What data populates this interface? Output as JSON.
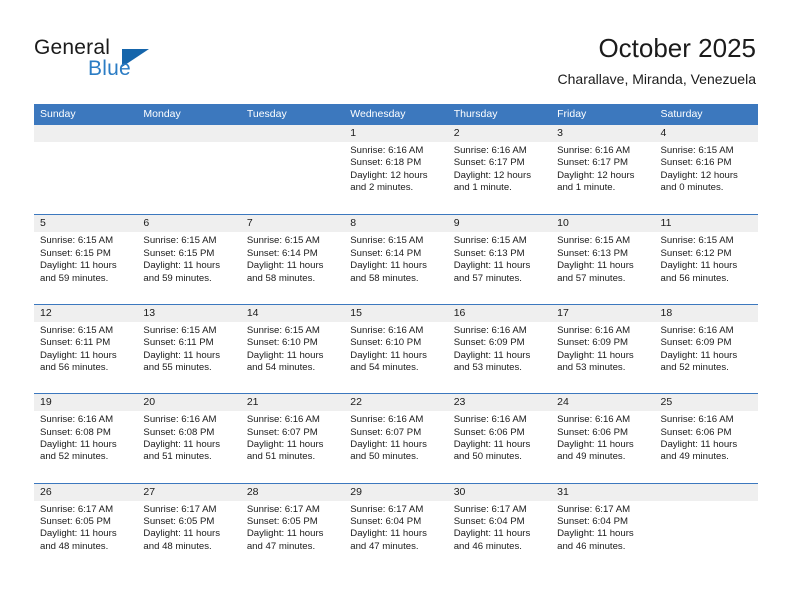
{
  "logo": {
    "top_text": "General",
    "bottom_text": "Blue",
    "triangle_icon": "triangle-icon",
    "brand_blue": "#2b7cc4",
    "triangle_color": "#1565ab"
  },
  "header": {
    "title": "October 2025",
    "subtitle": "Charallave, Miranda, Venezuela"
  },
  "colors": {
    "header_band": "#3c78be",
    "day_strip": "#efefef",
    "text": "#1b1b1b"
  },
  "weekdays": [
    "Sunday",
    "Monday",
    "Tuesday",
    "Wednesday",
    "Thursday",
    "Friday",
    "Saturday"
  ],
  "weeks": [
    [
      {
        "empty": true,
        "day": "",
        "sunrise": "",
        "sunset": "",
        "daylight": ""
      },
      {
        "empty": true,
        "day": "",
        "sunrise": "",
        "sunset": "",
        "daylight": ""
      },
      {
        "empty": true,
        "day": "",
        "sunrise": "",
        "sunset": "",
        "daylight": ""
      },
      {
        "empty": false,
        "day": "1",
        "sunrise": "Sunrise: 6:16 AM",
        "sunset": "Sunset: 6:18 PM",
        "daylight": "Daylight: 12 hours and 2 minutes."
      },
      {
        "empty": false,
        "day": "2",
        "sunrise": "Sunrise: 6:16 AM",
        "sunset": "Sunset: 6:17 PM",
        "daylight": "Daylight: 12 hours and 1 minute."
      },
      {
        "empty": false,
        "day": "3",
        "sunrise": "Sunrise: 6:16 AM",
        "sunset": "Sunset: 6:17 PM",
        "daylight": "Daylight: 12 hours and 1 minute."
      },
      {
        "empty": false,
        "day": "4",
        "sunrise": "Sunrise: 6:15 AM",
        "sunset": "Sunset: 6:16 PM",
        "daylight": "Daylight: 12 hours and 0 minutes."
      }
    ],
    [
      {
        "empty": false,
        "day": "5",
        "sunrise": "Sunrise: 6:15 AM",
        "sunset": "Sunset: 6:15 PM",
        "daylight": "Daylight: 11 hours and 59 minutes."
      },
      {
        "empty": false,
        "day": "6",
        "sunrise": "Sunrise: 6:15 AM",
        "sunset": "Sunset: 6:15 PM",
        "daylight": "Daylight: 11 hours and 59 minutes."
      },
      {
        "empty": false,
        "day": "7",
        "sunrise": "Sunrise: 6:15 AM",
        "sunset": "Sunset: 6:14 PM",
        "daylight": "Daylight: 11 hours and 58 minutes."
      },
      {
        "empty": false,
        "day": "8",
        "sunrise": "Sunrise: 6:15 AM",
        "sunset": "Sunset: 6:14 PM",
        "daylight": "Daylight: 11 hours and 58 minutes."
      },
      {
        "empty": false,
        "day": "9",
        "sunrise": "Sunrise: 6:15 AM",
        "sunset": "Sunset: 6:13 PM",
        "daylight": "Daylight: 11 hours and 57 minutes."
      },
      {
        "empty": false,
        "day": "10",
        "sunrise": "Sunrise: 6:15 AM",
        "sunset": "Sunset: 6:13 PM",
        "daylight": "Daylight: 11 hours and 57 minutes."
      },
      {
        "empty": false,
        "day": "11",
        "sunrise": "Sunrise: 6:15 AM",
        "sunset": "Sunset: 6:12 PM",
        "daylight": "Daylight: 11 hours and 56 minutes."
      }
    ],
    [
      {
        "empty": false,
        "day": "12",
        "sunrise": "Sunrise: 6:15 AM",
        "sunset": "Sunset: 6:11 PM",
        "daylight": "Daylight: 11 hours and 56 minutes."
      },
      {
        "empty": false,
        "day": "13",
        "sunrise": "Sunrise: 6:15 AM",
        "sunset": "Sunset: 6:11 PM",
        "daylight": "Daylight: 11 hours and 55 minutes."
      },
      {
        "empty": false,
        "day": "14",
        "sunrise": "Sunrise: 6:15 AM",
        "sunset": "Sunset: 6:10 PM",
        "daylight": "Daylight: 11 hours and 54 minutes."
      },
      {
        "empty": false,
        "day": "15",
        "sunrise": "Sunrise: 6:16 AM",
        "sunset": "Sunset: 6:10 PM",
        "daylight": "Daylight: 11 hours and 54 minutes."
      },
      {
        "empty": false,
        "day": "16",
        "sunrise": "Sunrise: 6:16 AM",
        "sunset": "Sunset: 6:09 PM",
        "daylight": "Daylight: 11 hours and 53 minutes."
      },
      {
        "empty": false,
        "day": "17",
        "sunrise": "Sunrise: 6:16 AM",
        "sunset": "Sunset: 6:09 PM",
        "daylight": "Daylight: 11 hours and 53 minutes."
      },
      {
        "empty": false,
        "day": "18",
        "sunrise": "Sunrise: 6:16 AM",
        "sunset": "Sunset: 6:09 PM",
        "daylight": "Daylight: 11 hours and 52 minutes."
      }
    ],
    [
      {
        "empty": false,
        "day": "19",
        "sunrise": "Sunrise: 6:16 AM",
        "sunset": "Sunset: 6:08 PM",
        "daylight": "Daylight: 11 hours and 52 minutes."
      },
      {
        "empty": false,
        "day": "20",
        "sunrise": "Sunrise: 6:16 AM",
        "sunset": "Sunset: 6:08 PM",
        "daylight": "Daylight: 11 hours and 51 minutes."
      },
      {
        "empty": false,
        "day": "21",
        "sunrise": "Sunrise: 6:16 AM",
        "sunset": "Sunset: 6:07 PM",
        "daylight": "Daylight: 11 hours and 51 minutes."
      },
      {
        "empty": false,
        "day": "22",
        "sunrise": "Sunrise: 6:16 AM",
        "sunset": "Sunset: 6:07 PM",
        "daylight": "Daylight: 11 hours and 50 minutes."
      },
      {
        "empty": false,
        "day": "23",
        "sunrise": "Sunrise: 6:16 AM",
        "sunset": "Sunset: 6:06 PM",
        "daylight": "Daylight: 11 hours and 50 minutes."
      },
      {
        "empty": false,
        "day": "24",
        "sunrise": "Sunrise: 6:16 AM",
        "sunset": "Sunset: 6:06 PM",
        "daylight": "Daylight: 11 hours and 49 minutes."
      },
      {
        "empty": false,
        "day": "25",
        "sunrise": "Sunrise: 6:16 AM",
        "sunset": "Sunset: 6:06 PM",
        "daylight": "Daylight: 11 hours and 49 minutes."
      }
    ],
    [
      {
        "empty": false,
        "day": "26",
        "sunrise": "Sunrise: 6:17 AM",
        "sunset": "Sunset: 6:05 PM",
        "daylight": "Daylight: 11 hours and 48 minutes."
      },
      {
        "empty": false,
        "day": "27",
        "sunrise": "Sunrise: 6:17 AM",
        "sunset": "Sunset: 6:05 PM",
        "daylight": "Daylight: 11 hours and 48 minutes."
      },
      {
        "empty": false,
        "day": "28",
        "sunrise": "Sunrise: 6:17 AM",
        "sunset": "Sunset: 6:05 PM",
        "daylight": "Daylight: 11 hours and 47 minutes."
      },
      {
        "empty": false,
        "day": "29",
        "sunrise": "Sunrise: 6:17 AM",
        "sunset": "Sunset: 6:04 PM",
        "daylight": "Daylight: 11 hours and 47 minutes."
      },
      {
        "empty": false,
        "day": "30",
        "sunrise": "Sunrise: 6:17 AM",
        "sunset": "Sunset: 6:04 PM",
        "daylight": "Daylight: 11 hours and 46 minutes."
      },
      {
        "empty": false,
        "day": "31",
        "sunrise": "Sunrise: 6:17 AM",
        "sunset": "Sunset: 6:04 PM",
        "daylight": "Daylight: 11 hours and 46 minutes."
      },
      {
        "empty": true,
        "day": "",
        "sunrise": "",
        "sunset": "",
        "daylight": ""
      }
    ]
  ]
}
